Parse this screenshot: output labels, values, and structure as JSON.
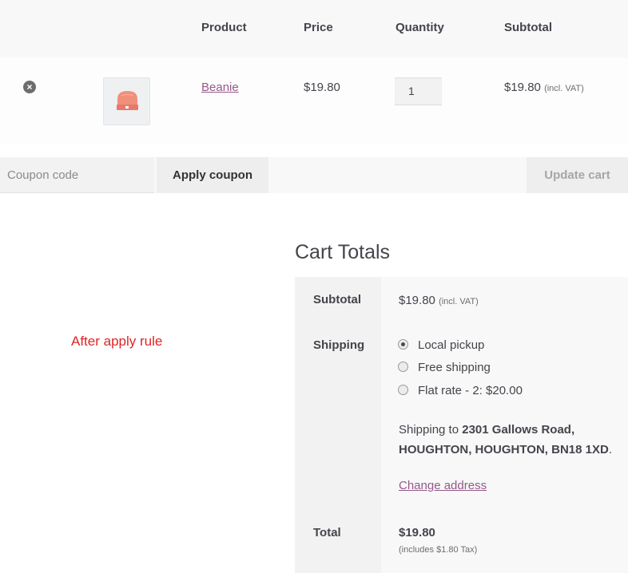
{
  "table": {
    "headers": {
      "product": "Product",
      "price": "Price",
      "quantity": "Quantity",
      "subtotal": "Subtotal"
    },
    "row": {
      "remove_icon": "close-circle-icon",
      "product_name": "Beanie",
      "price": "$19.80",
      "quantity": "1",
      "subtotal": "$19.80",
      "subtotal_note": "(incl. VAT)"
    }
  },
  "actions": {
    "coupon_placeholder": "Coupon code",
    "apply_label": "Apply coupon",
    "update_label": "Update cart"
  },
  "note": "After apply rule",
  "totals": {
    "title": "Cart Totals",
    "subtotal_label": "Subtotal",
    "subtotal_value": "$19.80",
    "subtotal_note": "(incl. VAT)",
    "shipping_label": "Shipping",
    "shipping_options": [
      {
        "label": "Local pickup",
        "selected": true
      },
      {
        "label": "Free shipping",
        "selected": false
      },
      {
        "label": "Flat rate - 2: $20.00",
        "selected": false
      }
    ],
    "shipping_to_prefix": "Shipping to",
    "shipping_to_line1": "2301 Gallows Road,",
    "shipping_to_line2": "HOUGHTON, HOUGHTON, BN18 1XD",
    "change_address": "Change address",
    "total_label": "Total",
    "total_value": "$19.80",
    "total_tax": "(includes $1.80 Tax)"
  },
  "colors": {
    "link": "#96588a",
    "note": "#e02424",
    "beanie": "#f0907a"
  }
}
